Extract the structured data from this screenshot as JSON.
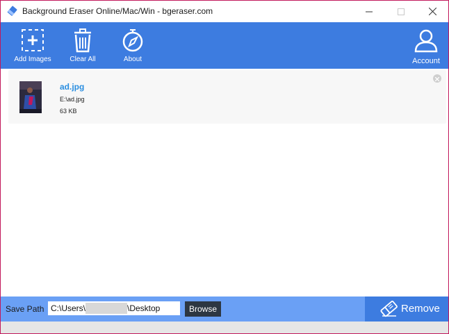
{
  "window": {
    "title": "Background Eraser Online/Mac/Win - bgeraser.com"
  },
  "toolbar": {
    "add_images_label": "Add Images",
    "clear_all_label": "Clear All",
    "about_label": "About",
    "account_label": "Account"
  },
  "files": [
    {
      "name": "ad.jpg",
      "path": "E:\\ad.jpg",
      "size": "63 KB"
    }
  ],
  "bottom": {
    "save_path_label": "Save Path",
    "save_path_prefix": "C:\\Users\\",
    "save_path_suffix": "\\Desktop",
    "browse_label": "Browse",
    "remove_label": "Remove"
  },
  "colors": {
    "toolbar_bg": "#3d7ce0",
    "bottom_bar_bg": "#6aa0f5",
    "file_name": "#2a8ee0",
    "browse_bg": "#2d3742",
    "window_border": "#c2185b"
  },
  "icons": {
    "app": "eraser-icon",
    "add_images": "add-dashed-square-icon",
    "clear_all": "trash-icon",
    "about": "compass-icon",
    "account": "user-icon",
    "remove": "eraser-icon"
  }
}
